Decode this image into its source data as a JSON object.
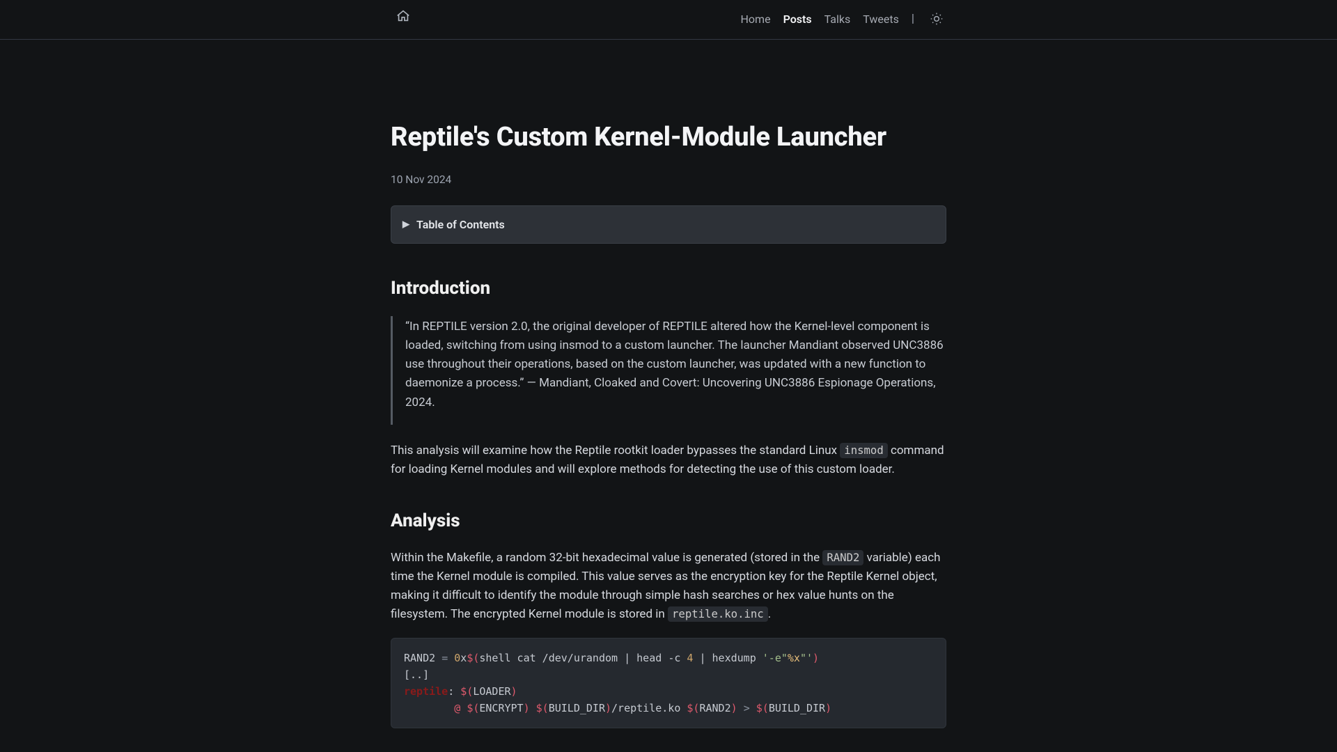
{
  "nav": {
    "items": [
      {
        "label": "Home",
        "active": false
      },
      {
        "label": "Posts",
        "active": true
      },
      {
        "label": "Talks",
        "active": false
      },
      {
        "label": "Tweets",
        "active": false
      }
    ],
    "separator": "|",
    "home_icon": "home-icon",
    "theme_icon": "sun-icon"
  },
  "article": {
    "title": "Reptile's Custom Kernel-Module Launcher",
    "date": "10 Nov 2024",
    "toc_label": "Table of Contents",
    "sections": {
      "intro": {
        "heading": "Introduction",
        "quote": "“In REPTILE version 2.0, the original developer of REPTILE altered how the Kernel-level component is loaded, switching from using insmod to a custom launcher. The launcher Mandiant observed UNC3886 use throughout their operations, based on the custom launcher, was updated with a new function to daemonize a process.” — Mandiant, Cloaked and Covert: Uncovering UNC3886 Espionage Operations, 2024.",
        "p1_a": "This analysis will examine how the Reptile rootkit loader bypasses the standard Linux ",
        "p1_code": "insmod",
        "p1_b": " command for loading Kernel modules and will explore methods for detecting the use of this custom loader."
      },
      "analysis": {
        "heading": "Analysis",
        "p1_a": "Within the Makefile, a random 32-bit hexadecimal value is generated (stored in the ",
        "p1_code": "RAND2",
        "p1_b": " variable) each time the Kernel module is compiled. This value serves as the encryption key for the Reptile Kernel object, making it difficult to identify the module through simple hash searches or hex value hunts on the filesystem. The encrypted Kernel module is stored in ",
        "p1_code2": "reptile.ko.inc",
        "p1_c": "."
      }
    },
    "code": {
      "makefile": {
        "tokens": [
          [
            {
              "t": "RAND2",
              "c": "p"
            },
            {
              "t": " ",
              "c": "p"
            },
            {
              "t": "=",
              "c": "o"
            },
            {
              "t": " ",
              "c": "p"
            },
            {
              "t": "0",
              "c": "n"
            },
            {
              "t": "x",
              "c": "p"
            },
            {
              "t": "$(",
              "c": "d"
            },
            {
              "t": "shell cat /dev/urandom | head ",
              "c": "p"
            },
            {
              "t": "-c",
              "c": "p"
            },
            {
              "t": " ",
              "c": "p"
            },
            {
              "t": "4",
              "c": "n"
            },
            {
              "t": " | hexdump ",
              "c": "p"
            },
            {
              "t": "'-e",
              "c": "s"
            },
            {
              "t": "\"",
              "c": "s"
            },
            {
              "t": "%x",
              "c": "v"
            },
            {
              "t": "\"",
              "c": "s"
            },
            {
              "t": "'",
              "c": "s"
            },
            {
              "t": ")",
              "c": "d"
            }
          ],
          [
            {
              "t": "[..]",
              "c": "p"
            }
          ],
          [
            {
              "t": "reptile",
              "c": "dr"
            },
            {
              "t": ": ",
              "c": "p"
            },
            {
              "t": "$(",
              "c": "d"
            },
            {
              "t": "LOADER",
              "c": "p"
            },
            {
              "t": ")",
              "c": "d"
            }
          ],
          [
            {
              "t": "        ",
              "c": "p"
            },
            {
              "t": "@",
              "c": "at"
            },
            {
              "t": " ",
              "c": "p"
            },
            {
              "t": "$(",
              "c": "d"
            },
            {
              "t": "ENCRYPT",
              "c": "p"
            },
            {
              "t": ") ",
              "c": "d"
            },
            {
              "t": "$(",
              "c": "d"
            },
            {
              "t": "BUILD_DIR",
              "c": "p"
            },
            {
              "t": ")",
              "c": "d"
            },
            {
              "t": "/reptile.ko ",
              "c": "p"
            },
            {
              "t": "$(",
              "c": "d"
            },
            {
              "t": "RAND2",
              "c": "p"
            },
            {
              "t": ") ",
              "c": "d"
            },
            {
              "t": "> ",
              "c": "o"
            },
            {
              "t": "$(",
              "c": "d"
            },
            {
              "t": "BUILD_DIR",
              "c": "p"
            },
            {
              "t": ")",
              "c": "d"
            }
          ]
        ]
      }
    }
  }
}
